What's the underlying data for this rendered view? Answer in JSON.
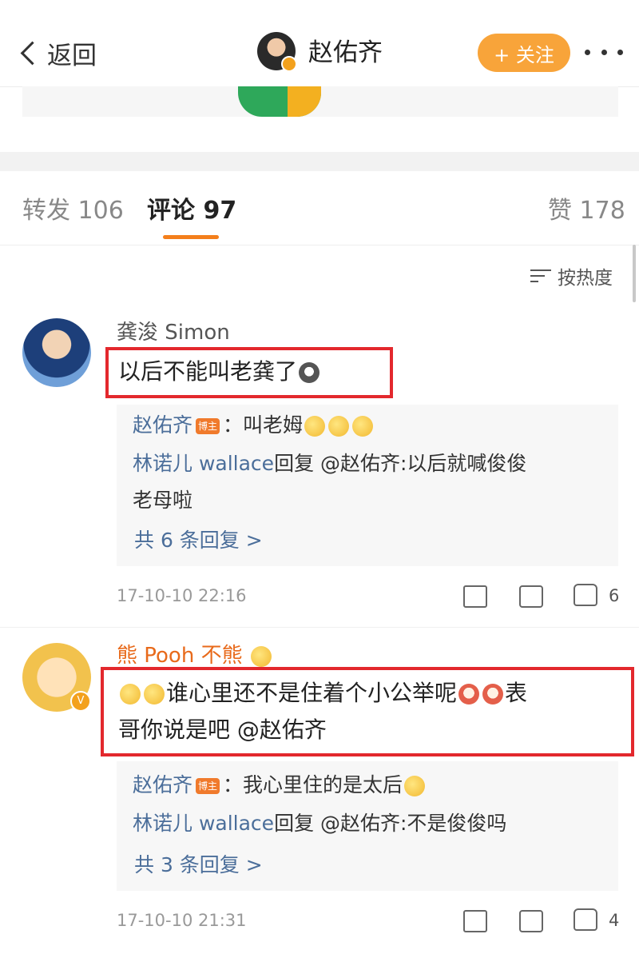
{
  "header": {
    "back_label": "返回",
    "user_name": "赵佑齐",
    "follow_label": "+ 关注"
  },
  "tabs": {
    "repost": "转发 106",
    "comment": "评论 97",
    "like": "赞 178"
  },
  "sort_label": "按热度",
  "comments": [
    {
      "user": "龚浚 Simon",
      "text": "以后不能叫老龚了",
      "replies": [
        {
          "user": "赵佑齐",
          "badge": "博主",
          "text": "：叫老姆"
        },
        {
          "user": "林诺儿 wallace",
          "text": "回复 @赵佑齐:以后就喊俊俊",
          "text_cont": "老母啦"
        }
      ],
      "more_replies": "共 6 条回复 >",
      "time": "17-10-10 22:16",
      "likes": "6"
    },
    {
      "user": "熊 Pooh 不熊",
      "text_line1": "谁心里还不是住着个小公举呢",
      "text_line1_tail": "表",
      "text_line2": "哥你说是吧 @赵佑齐",
      "replies": [
        {
          "user": "赵佑齐",
          "badge": "博主",
          "text": "：我心里住的是太后"
        },
        {
          "user": "林诺儿 wallace",
          "text": "回复 @赵佑齐:不是俊俊吗"
        }
      ],
      "more_replies": "共 3 条回复 >",
      "time": "17-10-10 21:31",
      "likes": "4"
    }
  ]
}
